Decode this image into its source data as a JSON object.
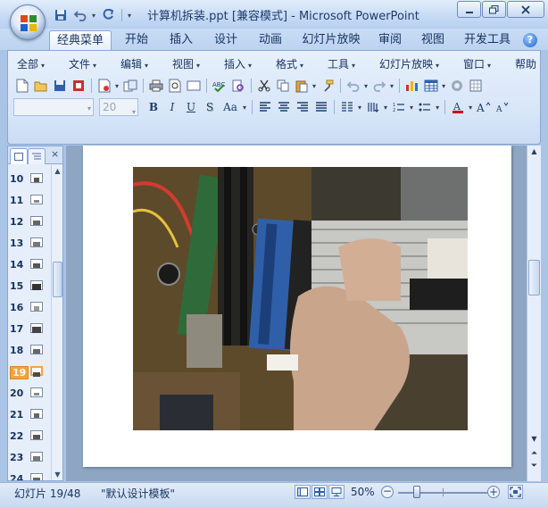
{
  "window": {
    "title": "计算机拆装.ppt [兼容模式] - Microsoft PowerPoint"
  },
  "ribbon": {
    "tabs": [
      {
        "label": "经典菜单",
        "active": true
      },
      {
        "label": "开始"
      },
      {
        "label": "插入"
      },
      {
        "label": "设计"
      },
      {
        "label": "动画"
      },
      {
        "label": "幻灯片放映"
      },
      {
        "label": "审阅"
      },
      {
        "label": "视图"
      },
      {
        "label": "开发工具"
      }
    ],
    "help_label": "?",
    "menus": [
      "全部",
      "文件",
      "编辑",
      "视图",
      "插入",
      "格式",
      "工具",
      "幻灯片放映",
      "窗口",
      "帮助"
    ],
    "font_name": "",
    "font_size": "20",
    "format_buttons": {
      "bold": "B",
      "italic": "I",
      "underline": "U",
      "shadow": "S",
      "case": "Aa"
    }
  },
  "slide_panel": {
    "slides": [
      {
        "number": "10"
      },
      {
        "number": "11"
      },
      {
        "number": "12"
      },
      {
        "number": "13"
      },
      {
        "number": "14"
      },
      {
        "number": "15"
      },
      {
        "number": "16"
      },
      {
        "number": "17"
      },
      {
        "number": "18"
      },
      {
        "number": "19",
        "selected": true
      },
      {
        "number": "20"
      },
      {
        "number": "21"
      },
      {
        "number": "22"
      },
      {
        "number": "23"
      },
      {
        "number": "24"
      }
    ],
    "close_label": "×"
  },
  "status": {
    "slide_info": "幻灯片 19/48",
    "template": "\"默认设计模板\"",
    "zoom": "50%"
  },
  "colors": {
    "accent": "#4a6fa5",
    "selected_slide": "#f4a33b"
  }
}
